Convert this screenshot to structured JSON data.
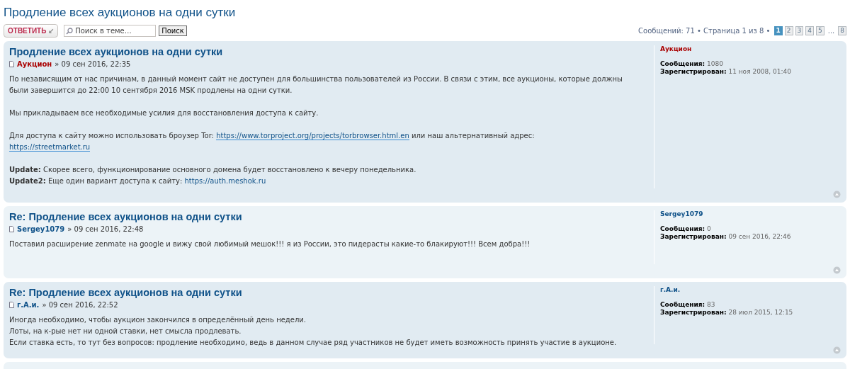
{
  "topic_title": "Продление всех аукционов на одни сутки",
  "toolbar": {
    "reply_button": "ОТВЕТИТЬ",
    "reply_icon": "↙",
    "search": {
      "placeholder": "Поиск в теме…"
    },
    "search_button": "Поиск"
  },
  "pagination": {
    "summary": "Сообщений: 71 • Страница 1 из 8 •",
    "pages": [
      {
        "kind": "page",
        "label": "1",
        "selected": true
      },
      {
        "kind": "page",
        "label": "2",
        "selected": false
      },
      {
        "kind": "page",
        "label": "3",
        "selected": false
      },
      {
        "kind": "page",
        "label": "4",
        "selected": false
      },
      {
        "kind": "page",
        "label": "5",
        "selected": false
      },
      {
        "kind": "ellipsis",
        "label": "..."
      },
      {
        "kind": "page",
        "label": "8",
        "selected": false
      }
    ]
  },
  "posts": [
    {
      "color": "#e1ebf2",
      "title": "Продление всех аукционов на одни сутки",
      "author": {
        "name": "Аукцион",
        "color": "#aa0000"
      },
      "date": "» 09 сен 2016, 22:35",
      "paragraphs": [
        [
          [
            {
              "kind": "text",
              "text": "По независящим от нас причинам, в данный момент сайт не доступен для большинства пользователей из России. В связи с этим, все аукционы, которые должны были завершится до 22:00 10 сентября 2016 MSK продлены на одни сутки."
            }
          ]
        ],
        [
          [
            {
              "kind": "text",
              "text": "Мы прикладываем все необходимые усилия для восстановления доступа к сайту."
            }
          ]
        ],
        [
          [
            {
              "kind": "text",
              "text": "Для доступа к сайту можно использовать броузер Tor: "
            },
            {
              "kind": "link",
              "text": "https://www.torproject.org/projects/torbrowser.html.en"
            },
            {
              "kind": "text",
              "text": " или наш альтернативный адрес:"
            }
          ],
          [
            {
              "kind": "link",
              "text": "https://streetmarket.ru"
            }
          ]
        ],
        [
          [
            {
              "kind": "bold",
              "text": "Update:"
            },
            {
              "kind": "text",
              "text": " Скорее всего, функционирование основного домена будет восстановлено к вечеру понедельника."
            }
          ],
          [
            {
              "kind": "bold",
              "text": "Update2:"
            },
            {
              "kind": "text",
              "text": " Еще один вариант доступа к сайту: "
            },
            {
              "kind": "plainlink",
              "text": "https://auth.meshok.ru"
            }
          ]
        ]
      ],
      "profile": {
        "name": "Аукцион",
        "posts_label": "Сообщения:",
        "posts": "1080",
        "registered_label": "Зарегистрирован:",
        "registered": "11 ноя 2008, 01:40"
      }
    },
    {
      "color": "#ecf3f7",
      "title": "Re: Продление всех аукционов на одни сутки",
      "author": {
        "name": "Sergey1079",
        "color": "#105289"
      },
      "date": "» 09 сен 2016, 22:48",
      "paragraphs": [
        [
          [
            {
              "kind": "text",
              "text": "Поставил расширение zenmate на google и вижу свой любимый мешок!!! я из России, это пидерасты какие-то блакируют!!! Всем добра!!!"
            }
          ]
        ]
      ],
      "profile": {
        "name": "Sergey1079",
        "posts_label": "Сообщения:",
        "posts": "0",
        "registered_label": "Зарегистрирован:",
        "registered": "09 сен 2016, 22:46"
      }
    },
    {
      "color": "#e1ebf2",
      "title": "Re: Продление всех аукционов на одни сутки",
      "author": {
        "name": "г.А.и.",
        "color": "#105289"
      },
      "date": "» 09 сен 2016, 22:52",
      "paragraphs": [
        [
          [
            {
              "kind": "text",
              "text": "Иногда необходимо, чтобы аукцион закончился в определённый день недели."
            }
          ],
          [
            {
              "kind": "text",
              "text": "Лоты, на к-рые нет ни одной ставки, нет смысла продлевать."
            }
          ],
          [
            {
              "kind": "text",
              "text": "Если ставка есть, то тут без вопросов: продление необходимо, ведь в данном случае ряд участников не будет иметь возможность принять участие в аукционе."
            }
          ]
        ]
      ],
      "profile": {
        "name": "г.А.и.",
        "posts_label": "Сообщения:",
        "posts": "83",
        "registered_label": "Зарегистрирован:",
        "registered": "28 июл 2015, 12:15"
      }
    }
  ]
}
